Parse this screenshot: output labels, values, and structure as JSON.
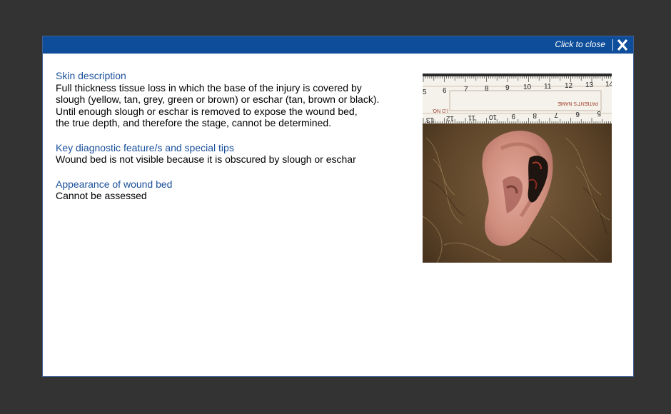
{
  "modal": {
    "close_label": "Click to close",
    "close_icon": "close-x-icon"
  },
  "sections": [
    {
      "heading": "Skin description",
      "body": "Full thickness tissue loss in which the base of the injury is covered by\nslough (yellow, tan, grey, green or brown) or eschar (tan, brown or black).\nUntil enough slough or eschar is removed to expose the wound bed,\nthe true depth, and therefore the stage, cannot be determined."
    },
    {
      "heading": "Key diagnostic feature/s and special tips",
      "body": "Wound bed is not visible because it is obscured by slough or eschar"
    },
    {
      "heading": "Appearance of wound bed",
      "body": "Cannot be assessed"
    }
  ],
  "photo": {
    "ruler_top_numbers": [
      "5",
      "6",
      "7",
      "8",
      "9",
      "10",
      "11",
      "12",
      "13",
      "14"
    ],
    "ruler_bottom_numbers": [
      "13",
      "12",
      "11",
      "10",
      "9",
      "8",
      "7",
      "6",
      "5"
    ],
    "ruler_id_label": "I.D NO.",
    "ruler_name_label": "PATIENT'S NAME"
  },
  "colors": {
    "header": "#0d4d9a",
    "heading_text": "#1a4f9a",
    "backdrop": "#333333"
  }
}
